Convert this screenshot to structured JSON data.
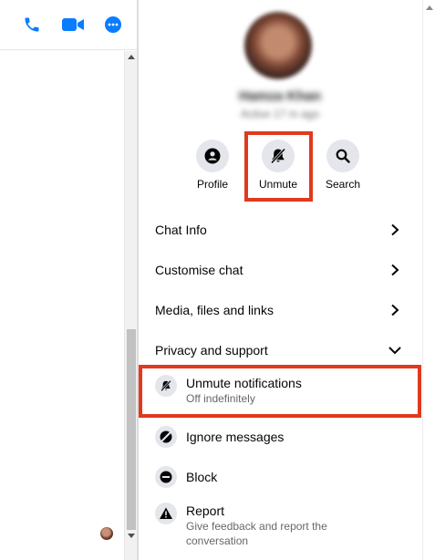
{
  "header_actions": [
    {
      "name": "call-button",
      "icon": "phone-icon"
    },
    {
      "name": "video-call-button",
      "icon": "video-camera-icon"
    },
    {
      "name": "more-options-button",
      "icon": "more-dots-icon"
    }
  ],
  "colors": {
    "accent": "#0a7cff",
    "highlight": "#e0391d",
    "icon_bg": "#e4e6eb",
    "secondary_text": "#65676b"
  },
  "profile": {
    "name": "Hamza Khan",
    "status": "Active 17 m ago"
  },
  "actions": [
    {
      "label": "Profile",
      "icon": "person-icon"
    },
    {
      "label": "Unmute",
      "icon": "bell-muted-icon"
    },
    {
      "label": "Search",
      "icon": "search-icon"
    }
  ],
  "menu": {
    "chat_info": "Chat Info",
    "customise_chat": "Customise chat",
    "media": "Media, files and links",
    "privacy": "Privacy and support"
  },
  "privacy_items": {
    "unmute": {
      "title": "Unmute notifications",
      "subtitle": "Off indefinitely"
    },
    "ignore": {
      "title": "Ignore messages"
    },
    "block": {
      "title": "Block"
    },
    "report": {
      "title": "Report",
      "subtitle": "Give feedback and report the conversation"
    }
  }
}
